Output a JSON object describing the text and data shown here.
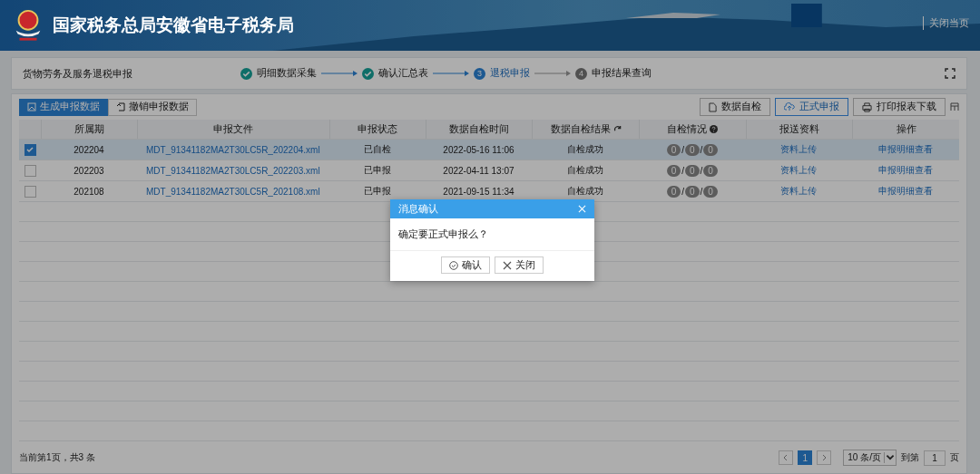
{
  "header": {
    "title": "国家税务总局安徽省电子税务局",
    "close_link": "关闭当页"
  },
  "page": {
    "title": "货物劳务及服务退税申报",
    "steps": [
      {
        "label": "明细数据采集",
        "kind": "done"
      },
      {
        "label": "确认汇总表",
        "kind": "done"
      },
      {
        "number": "3",
        "label": "退税申报",
        "kind": "current"
      },
      {
        "number": "4",
        "label": "申报结果查询",
        "kind": "todo"
      }
    ]
  },
  "tabs": [
    {
      "label": "生成申报数据",
      "selected": true
    },
    {
      "label": "撤销申报数据",
      "selected": false
    }
  ],
  "toolbar": [
    {
      "label": "数据自检",
      "kind": "file"
    },
    {
      "label": "正式申报",
      "kind": "upload"
    },
    {
      "label": "打印报表下载",
      "kind": "print"
    }
  ],
  "table": {
    "count_separator": "/",
    "columns": [
      "所属期",
      "申报文件",
      "申报状态",
      "数据自检时间",
      "数据自检结果",
      "自检情况",
      "报送资料",
      "操作"
    ],
    "rows": [
      {
        "selected": true,
        "checked": true,
        "period": "202204",
        "file": "MDT_91341182MA2T30LC5R_202204.xml",
        "status": "已自检",
        "time": "2022-05-16 11:06",
        "result": "自检成功",
        "counts": [
          "0",
          "0",
          "0"
        ],
        "upload": "资料上传",
        "action": "申报明细查看"
      },
      {
        "selected": false,
        "checked": false,
        "period": "202203",
        "file": "MDT_91341182MA2T30LC5R_202203.xml",
        "status": "已申报",
        "time": "2022-04-11 13:07",
        "result": "自检成功",
        "counts": [
          "0",
          "0",
          "0"
        ],
        "upload": "资料上传",
        "action": "申报明细查看"
      },
      {
        "selected": false,
        "checked": false,
        "period": "202108",
        "file": "MDT_91341182MA2T30LC5R_202108.xml",
        "status": "已申报",
        "time": "2021-09-15 11:34",
        "result": "自检成功",
        "counts": [
          "0",
          "0",
          "0"
        ],
        "upload": "资料上传",
        "action": "申报明细查看"
      }
    ]
  },
  "footer": {
    "summary": "当前第1页，共3 条",
    "pages": [
      {
        "label": "1",
        "selected": true
      }
    ],
    "page_size": "10 条/页",
    "goto_label": "到第",
    "goto_value": "1",
    "page_unit": "页"
  },
  "dialog": {
    "title": "消息确认",
    "message": "确定要正式申报么？",
    "buttons": [
      {
        "label": "确认",
        "kind": "confirm"
      },
      {
        "label": "关闭",
        "kind": "close"
      }
    ]
  }
}
